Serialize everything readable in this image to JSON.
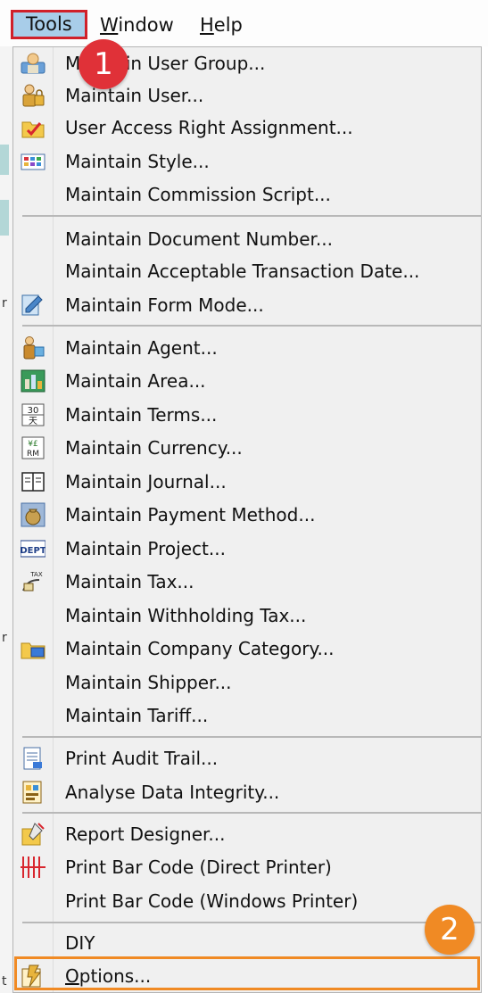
{
  "menubar": {
    "tools": "Tools",
    "window_first": "W",
    "window_rest": "indow",
    "help_first": "H",
    "help_rest": "elp"
  },
  "left_strip": {
    "chars": [
      "r",
      "r",
      "t"
    ]
  },
  "dropdown": {
    "items": [
      {
        "label": "Maintain User Group...",
        "icon": "user-group-icon"
      },
      {
        "label": "Maintain User...",
        "icon": "user-lock-icon"
      },
      {
        "label": "User Access Right Assignment...",
        "icon": "folder-check-icon"
      },
      {
        "label": "Maintain Style...",
        "icon": "style-palette-icon"
      },
      {
        "label": "Maintain Commission Script..."
      },
      {
        "label": "Maintain Document Number..."
      },
      {
        "label": "Maintain Acceptable Transaction Date..."
      },
      {
        "label": "Maintain Form Mode...",
        "icon": "form-mode-icon"
      },
      {
        "label": "Maintain Agent...",
        "icon": "agent-icon"
      },
      {
        "label": "Maintain Area...",
        "icon": "area-map-icon"
      },
      {
        "label": "Maintain Terms...",
        "icon": "terms-calendar-icon",
        "icon_text_top": "30",
        "icon_text_bottom": "天"
      },
      {
        "label": "Maintain Currency...",
        "icon": "currency-icon",
        "icon_text_top": "¥£",
        "icon_text_bottom": "RM"
      },
      {
        "label": "Maintain Journal...",
        "icon": "journal-book-icon"
      },
      {
        "label": "Maintain Payment Method...",
        "icon": "payment-bag-icon"
      },
      {
        "label": "Maintain Project...",
        "icon": "project-dept-icon",
        "icon_text": "DEPT"
      },
      {
        "label": "Maintain Tax...",
        "icon": "tax-icon",
        "icon_text": "TAX"
      },
      {
        "label": "Maintain Withholding Tax..."
      },
      {
        "label": "Maintain Company Category...",
        "icon": "company-category-icon"
      },
      {
        "label": "Maintain Shipper..."
      },
      {
        "label": "Maintain Tariff..."
      },
      {
        "label": "Print Audit Trail...",
        "icon": "audit-trail-icon"
      },
      {
        "label": "Analyse Data Integrity...",
        "icon": "data-integrity-icon"
      },
      {
        "label": "Report Designer...",
        "icon": "report-designer-icon"
      },
      {
        "label": "Print Bar Code (Direct Printer)",
        "icon": "barcode-icon"
      },
      {
        "label": "Print Bar Code (Windows Printer)"
      },
      {
        "label": "DIY"
      },
      {
        "label_first": "O",
        "label_rest": "ptions...",
        "icon": "options-icon"
      }
    ]
  },
  "annotations": {
    "step1": "1",
    "step2": "2"
  },
  "colors": {
    "tools_highlight_bg": "#a8cde9",
    "tools_border": "#d0202a",
    "badge1": "#e03138",
    "badge2": "#f08a24",
    "options_highlight_border": "#f08a24",
    "menu_bg": "#f0f0f0"
  }
}
